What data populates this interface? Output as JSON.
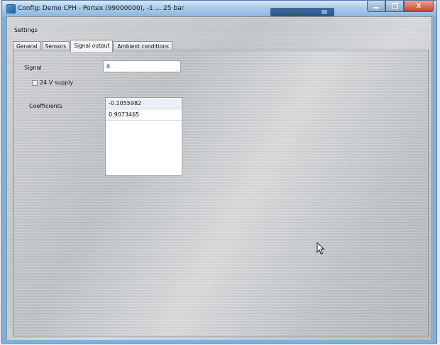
{
  "window": {
    "title": "Config: Demo CPH - Portex (99000000), -1 ... 25 bar",
    "icons": {
      "app": "app-icon",
      "minimize": "minimize-icon",
      "maximize": "maximize-icon",
      "close": "close-icon",
      "cursor": "mouse-pointer-icon"
    },
    "close_glyph": "X"
  },
  "settings": {
    "group_label": "Settings",
    "tabs": [
      {
        "label": "General",
        "active": false
      },
      {
        "label": "Sensors",
        "active": false
      },
      {
        "label": "Signal output",
        "active": true
      },
      {
        "label": "Ambient conditions",
        "active": false
      }
    ]
  },
  "signal_output": {
    "signal_label": "Signal",
    "signal_value": "4",
    "supply_label": "24 V supply",
    "supply_checked": false,
    "coefficients_label": "Coefficients",
    "coefficients": [
      "-0.1055982",
      "0.9073465"
    ]
  },
  "colors": {
    "title_bar": "#a9cbe9",
    "close_button": "#c7452a",
    "panel": "#c8cacd"
  }
}
